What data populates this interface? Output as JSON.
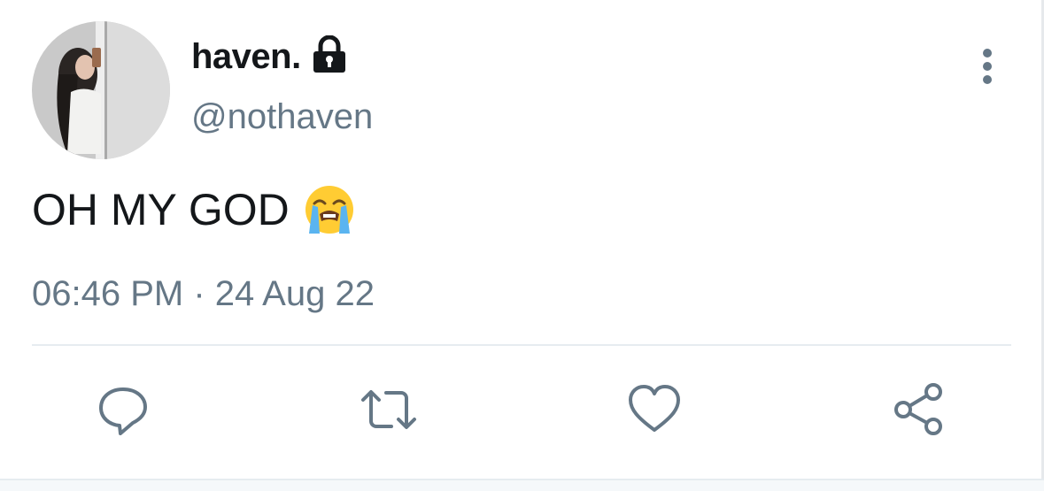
{
  "tweet": {
    "display_name": "haven.",
    "handle": "@nothaven",
    "text": "OH MY GOD",
    "timestamp": "06:46 PM · 24 Aug 22"
  },
  "icons": {
    "protected": "lock-icon",
    "menu": "more-vertical-icon",
    "emoji": "loudly-crying-face-emoji",
    "reply": "reply-icon",
    "retweet": "retweet-icon",
    "like": "heart-icon",
    "share": "share-icon"
  },
  "colors": {
    "name": "#14171a",
    "secondary": "#657786",
    "divider": "#e6ecf0"
  }
}
